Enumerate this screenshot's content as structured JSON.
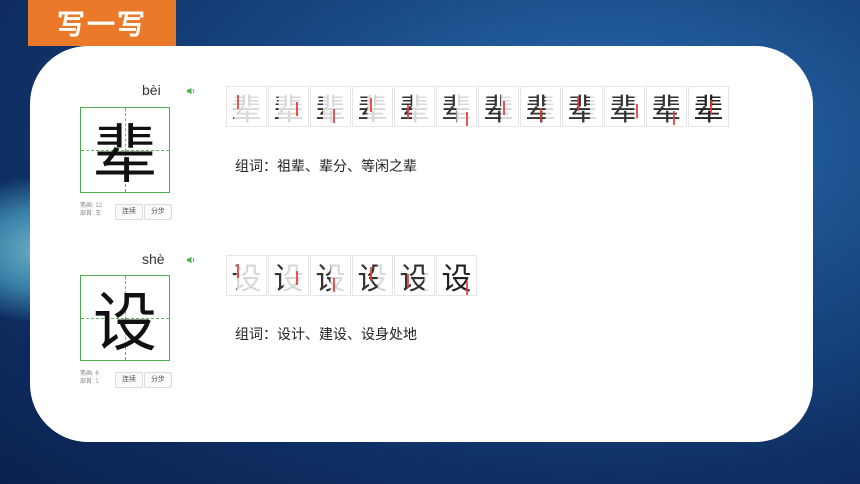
{
  "section_title": "写一写",
  "entries": [
    {
      "pinyin": "bèi",
      "character": "辈",
      "meta_strokes": "笔画: 12",
      "meta_radical": "部首: 车",
      "btn_continuous": "连续",
      "btn_step": "分步",
      "stroke_steps": [
        "辈",
        "辈",
        "辈",
        "辈",
        "辈",
        "辈",
        "辈",
        "辈",
        "辈",
        "辈",
        "辈",
        "辈"
      ],
      "words": "组词：祖辈、辈分、等闲之辈"
    },
    {
      "pinyin": "shè",
      "character": "设",
      "meta_strokes": "笔画: 6",
      "meta_radical": "部首: 讠",
      "btn_continuous": "连续",
      "btn_step": "分步",
      "stroke_steps": [
        "设",
        "设",
        "设",
        "设",
        "设",
        "设"
      ],
      "words": "组词：设计、建设、设身处地"
    }
  ],
  "colors": {
    "tab": "#ea7a2a",
    "grid": "#4caf50",
    "stroke_highlight": "#e53935"
  }
}
